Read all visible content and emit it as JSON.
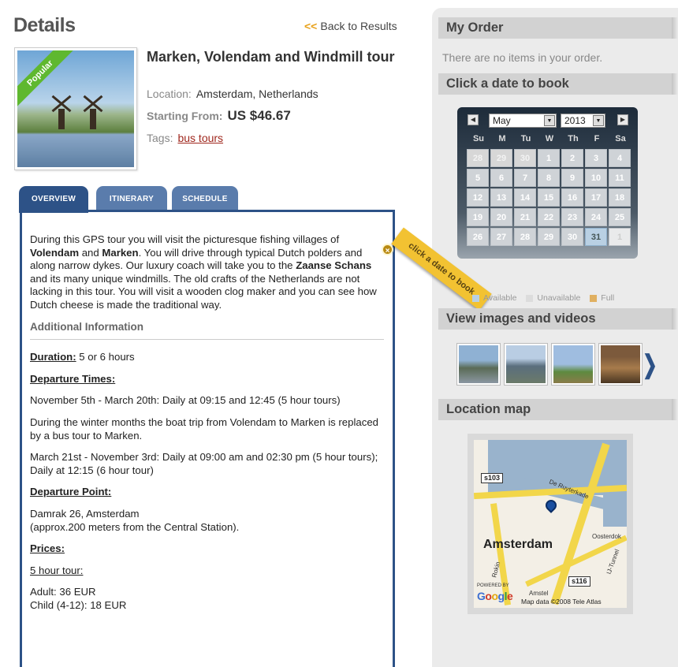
{
  "header": {
    "title": "Details",
    "back_arrow": "<<",
    "back_link": "Back to Results"
  },
  "tour": {
    "badge": "Popular",
    "title": "Marken, Volendam and Windmill tour",
    "location_label": "Location:",
    "location": "Amsterdam, Netherlands",
    "price_label": "Starting From:",
    "price": "US $46.67",
    "tags_label": "Tags:",
    "tag": "bus tours"
  },
  "tabs": [
    {
      "label": "OVERVIEW"
    },
    {
      "label": "ITINERARY"
    },
    {
      "label": "SCHEDULE"
    }
  ],
  "overview": {
    "p1_a": "During this GPS tour you will visit the picturesque fishing villages of ",
    "p1_b": "Volendam",
    "p1_c": " and ",
    "p1_d": "Marken",
    "p1_e": ". You will drive through typical Dutch polders and along narrow dykes. Our luxury coach will take you to the ",
    "p1_f": "Zaanse Schans",
    "p1_g": " and its many unique windmills. The old crafts of the Netherlands are not lacking in this tour. You will visit a wooden clog maker and you can see how Dutch cheese is made the traditional way.",
    "additional": "Additional Information",
    "duration_label": "Duration:",
    "duration": " 5 or 6 hours",
    "departure_times_label": "Departure Times:",
    "times_1": "November 5th  - March 20th: Daily at 09:15 and 12:45 (5 hour tours)",
    "times_2": "During the winter months the boat trip from Volendam to Marken is replaced by a bus tour to Marken.",
    "times_3": "March 21st - November 3rd: Daily at 09:00 am and 02:30 pm (5 hour tours); Daily at 12:15 (6 hour tour)",
    "departure_point_label": "Departure Point:",
    "point_1": "Damrak 26, Amsterdam",
    "point_2": "(approx.200 meters from the Central Station).",
    "prices_label": "Prices:",
    "five_hour": "5 hour tour:",
    "adult": "Adult: 36 EUR",
    "child": "Child (4-12): 18 EUR"
  },
  "sidebar": {
    "order_title": "My Order",
    "order_empty": "There are no items in your order.",
    "book_title": "Click a date to book",
    "media_title": "View images and videos",
    "map_title": "Location map"
  },
  "calendar": {
    "month": "May",
    "year": "2013",
    "prev_icon": "◀",
    "next_icon": "▶",
    "dropdown_icon": "▼",
    "dows": [
      "Su",
      "M",
      "Tu",
      "W",
      "Th",
      "F",
      "Sa"
    ],
    "days": [
      {
        "d": "28",
        "s": "other"
      },
      {
        "d": "29",
        "s": "other"
      },
      {
        "d": "30",
        "s": "other"
      },
      {
        "d": "1",
        "s": "un"
      },
      {
        "d": "2",
        "s": "un"
      },
      {
        "d": "3",
        "s": "un"
      },
      {
        "d": "4",
        "s": "un"
      },
      {
        "d": "5",
        "s": "un"
      },
      {
        "d": "6",
        "s": "un"
      },
      {
        "d": "7",
        "s": "un"
      },
      {
        "d": "8",
        "s": "un"
      },
      {
        "d": "9",
        "s": "un"
      },
      {
        "d": "10",
        "s": "un"
      },
      {
        "d": "11",
        "s": "un"
      },
      {
        "d": "12",
        "s": "un"
      },
      {
        "d": "13",
        "s": "un"
      },
      {
        "d": "14",
        "s": "un"
      },
      {
        "d": "15",
        "s": "un"
      },
      {
        "d": "16",
        "s": "un"
      },
      {
        "d": "17",
        "s": "un"
      },
      {
        "d": "18",
        "s": "un"
      },
      {
        "d": "19",
        "s": "un"
      },
      {
        "d": "20",
        "s": "un"
      },
      {
        "d": "21",
        "s": "un"
      },
      {
        "d": "22",
        "s": "un"
      },
      {
        "d": "23",
        "s": "un"
      },
      {
        "d": "24",
        "s": "un"
      },
      {
        "d": "25",
        "s": "un"
      },
      {
        "d": "26",
        "s": "un"
      },
      {
        "d": "27",
        "s": "un"
      },
      {
        "d": "28",
        "s": "un"
      },
      {
        "d": "29",
        "s": "un"
      },
      {
        "d": "30",
        "s": "un"
      },
      {
        "d": "31",
        "s": "avail"
      },
      {
        "d": "1",
        "s": "next"
      }
    ],
    "sticker": "click a date to book",
    "sticker_close": "×",
    "legend": [
      {
        "label": "Available",
        "color": "#b9d0e3"
      },
      {
        "label": "Unavailable",
        "color": "#dcdcdc"
      },
      {
        "label": "Full",
        "color": "#e0b061"
      }
    ]
  },
  "media": {
    "next_icon": "❯",
    "thumbs": [
      "image-1",
      "image-2",
      "image-3",
      "image-4"
    ]
  },
  "map": {
    "city": "Amsterdam",
    "shield_1": "s103",
    "shield_2": "s116",
    "street": "De Ruyterkade",
    "area": "Oosterdok",
    "road": "IJ-Tunnel",
    "powered_by": "POWERED BY",
    "google": [
      "G",
      "o",
      "o",
      "g",
      "l",
      "e"
    ],
    "data": "Map data ©2008 Tele Atlas",
    "canal": "Rokin",
    "district": "Amstel"
  },
  "colors": {
    "tab_active": "#2d5287",
    "link": "#a0281e",
    "arrow": "#e8a21b",
    "sticker": "#f2c232"
  }
}
